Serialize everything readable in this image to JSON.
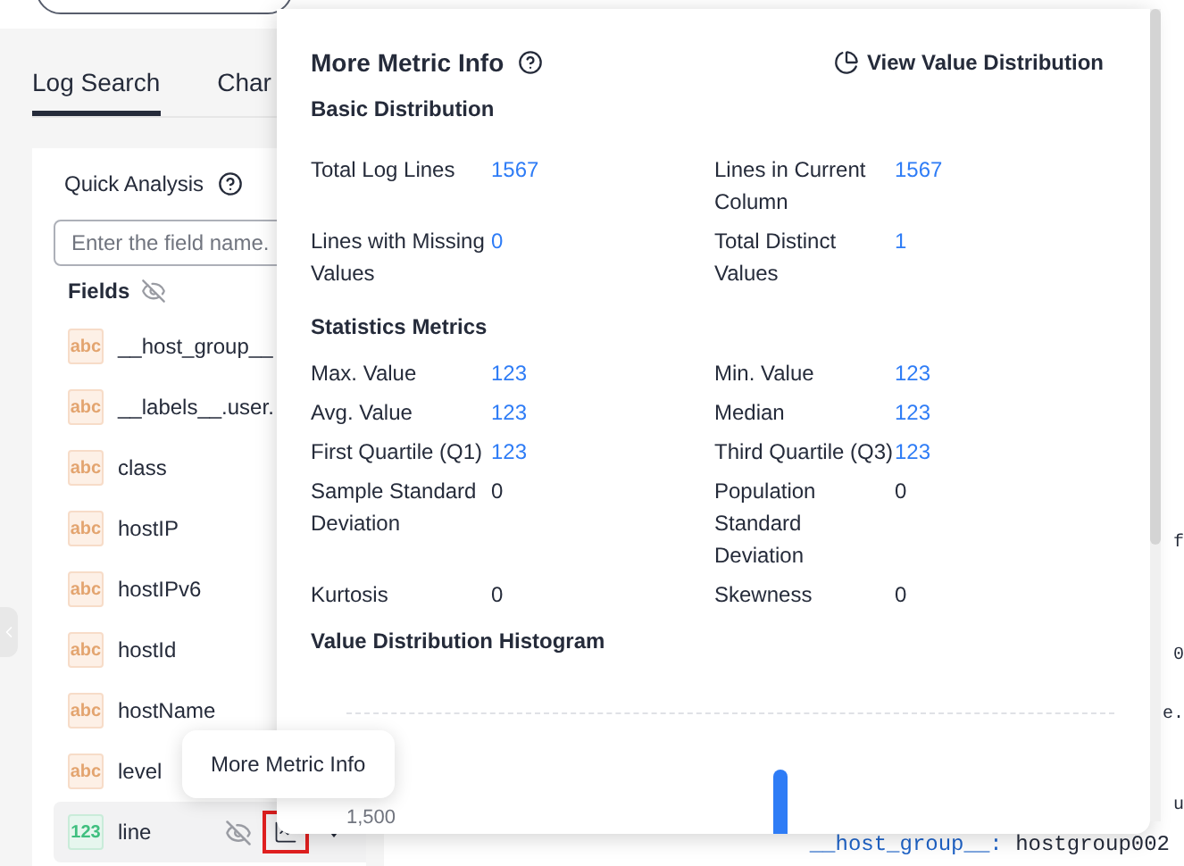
{
  "tabs": [
    {
      "label": "Log Search",
      "selected": true
    },
    {
      "label": "Char",
      "selected": false
    }
  ],
  "quick_analysis": {
    "title": "Quick Analysis",
    "search": {
      "placeholder": "Enter the field name."
    },
    "fields_label": "Fields",
    "fields": [
      {
        "kind": "text",
        "badge": "abc",
        "name": "__host_group__",
        "selected": false
      },
      {
        "kind": "text",
        "badge": "abc",
        "name": "__labels__.user.",
        "selected": false
      },
      {
        "kind": "text",
        "badge": "abc",
        "name": "class",
        "selected": false
      },
      {
        "kind": "text",
        "badge": "abc",
        "name": "hostIP",
        "selected": false
      },
      {
        "kind": "text",
        "badge": "abc",
        "name": "hostIPv6",
        "selected": false
      },
      {
        "kind": "text",
        "badge": "abc",
        "name": "hostId",
        "selected": false
      },
      {
        "kind": "text",
        "badge": "abc",
        "name": "hostName",
        "selected": false
      },
      {
        "kind": "text",
        "badge": "abc",
        "name": "level",
        "selected": false
      },
      {
        "kind": "number",
        "badge": "123",
        "name": "line",
        "selected": true
      }
    ]
  },
  "tooltip": "More Metric Info",
  "log_fragments": [
    "f",
    "0",
    "e.",
    "u"
  ],
  "log_line": {
    "key": "__host_group__:",
    "value": "hostgroup002"
  },
  "metric_popup": {
    "title": "More Metric Info",
    "action": "View Value Distribution",
    "sections": [
      {
        "title": "Basic Distribution",
        "metrics": [
          {
            "label": "Total Log Lines",
            "value": "1567",
            "linked": true
          },
          {
            "label": "Lines in Current Column",
            "value": "1567",
            "linked": true
          },
          {
            "label": "Lines with Missing Values",
            "value": "0",
            "linked": true
          },
          {
            "label": "Total Distinct Values",
            "value": "1",
            "linked": true
          }
        ]
      },
      {
        "title": "Statistics Metrics",
        "metrics": [
          {
            "label": "Max. Value",
            "value": "123",
            "linked": true
          },
          {
            "label": "Min. Value",
            "value": "123",
            "linked": true
          },
          {
            "label": "Avg. Value",
            "value": "123",
            "linked": true
          },
          {
            "label": "Median",
            "value": "123",
            "linked": true
          },
          {
            "label": "First Quartile (Q1)",
            "value": "123",
            "linked": true
          },
          {
            "label": "Third Quartile (Q3)",
            "value": "123",
            "linked": true
          },
          {
            "label": "Sample Standard Deviation",
            "value": "0",
            "linked": false
          },
          {
            "label": "Population Standard Deviation",
            "value": "0",
            "linked": false
          },
          {
            "label": "Kurtosis",
            "value": "0",
            "linked": false
          },
          {
            "label": "Skewness",
            "value": "0",
            "linked": false
          }
        ]
      }
    ],
    "histogram": {
      "title": "Value Distribution Histogram",
      "tick_label": "1,500"
    }
  }
}
